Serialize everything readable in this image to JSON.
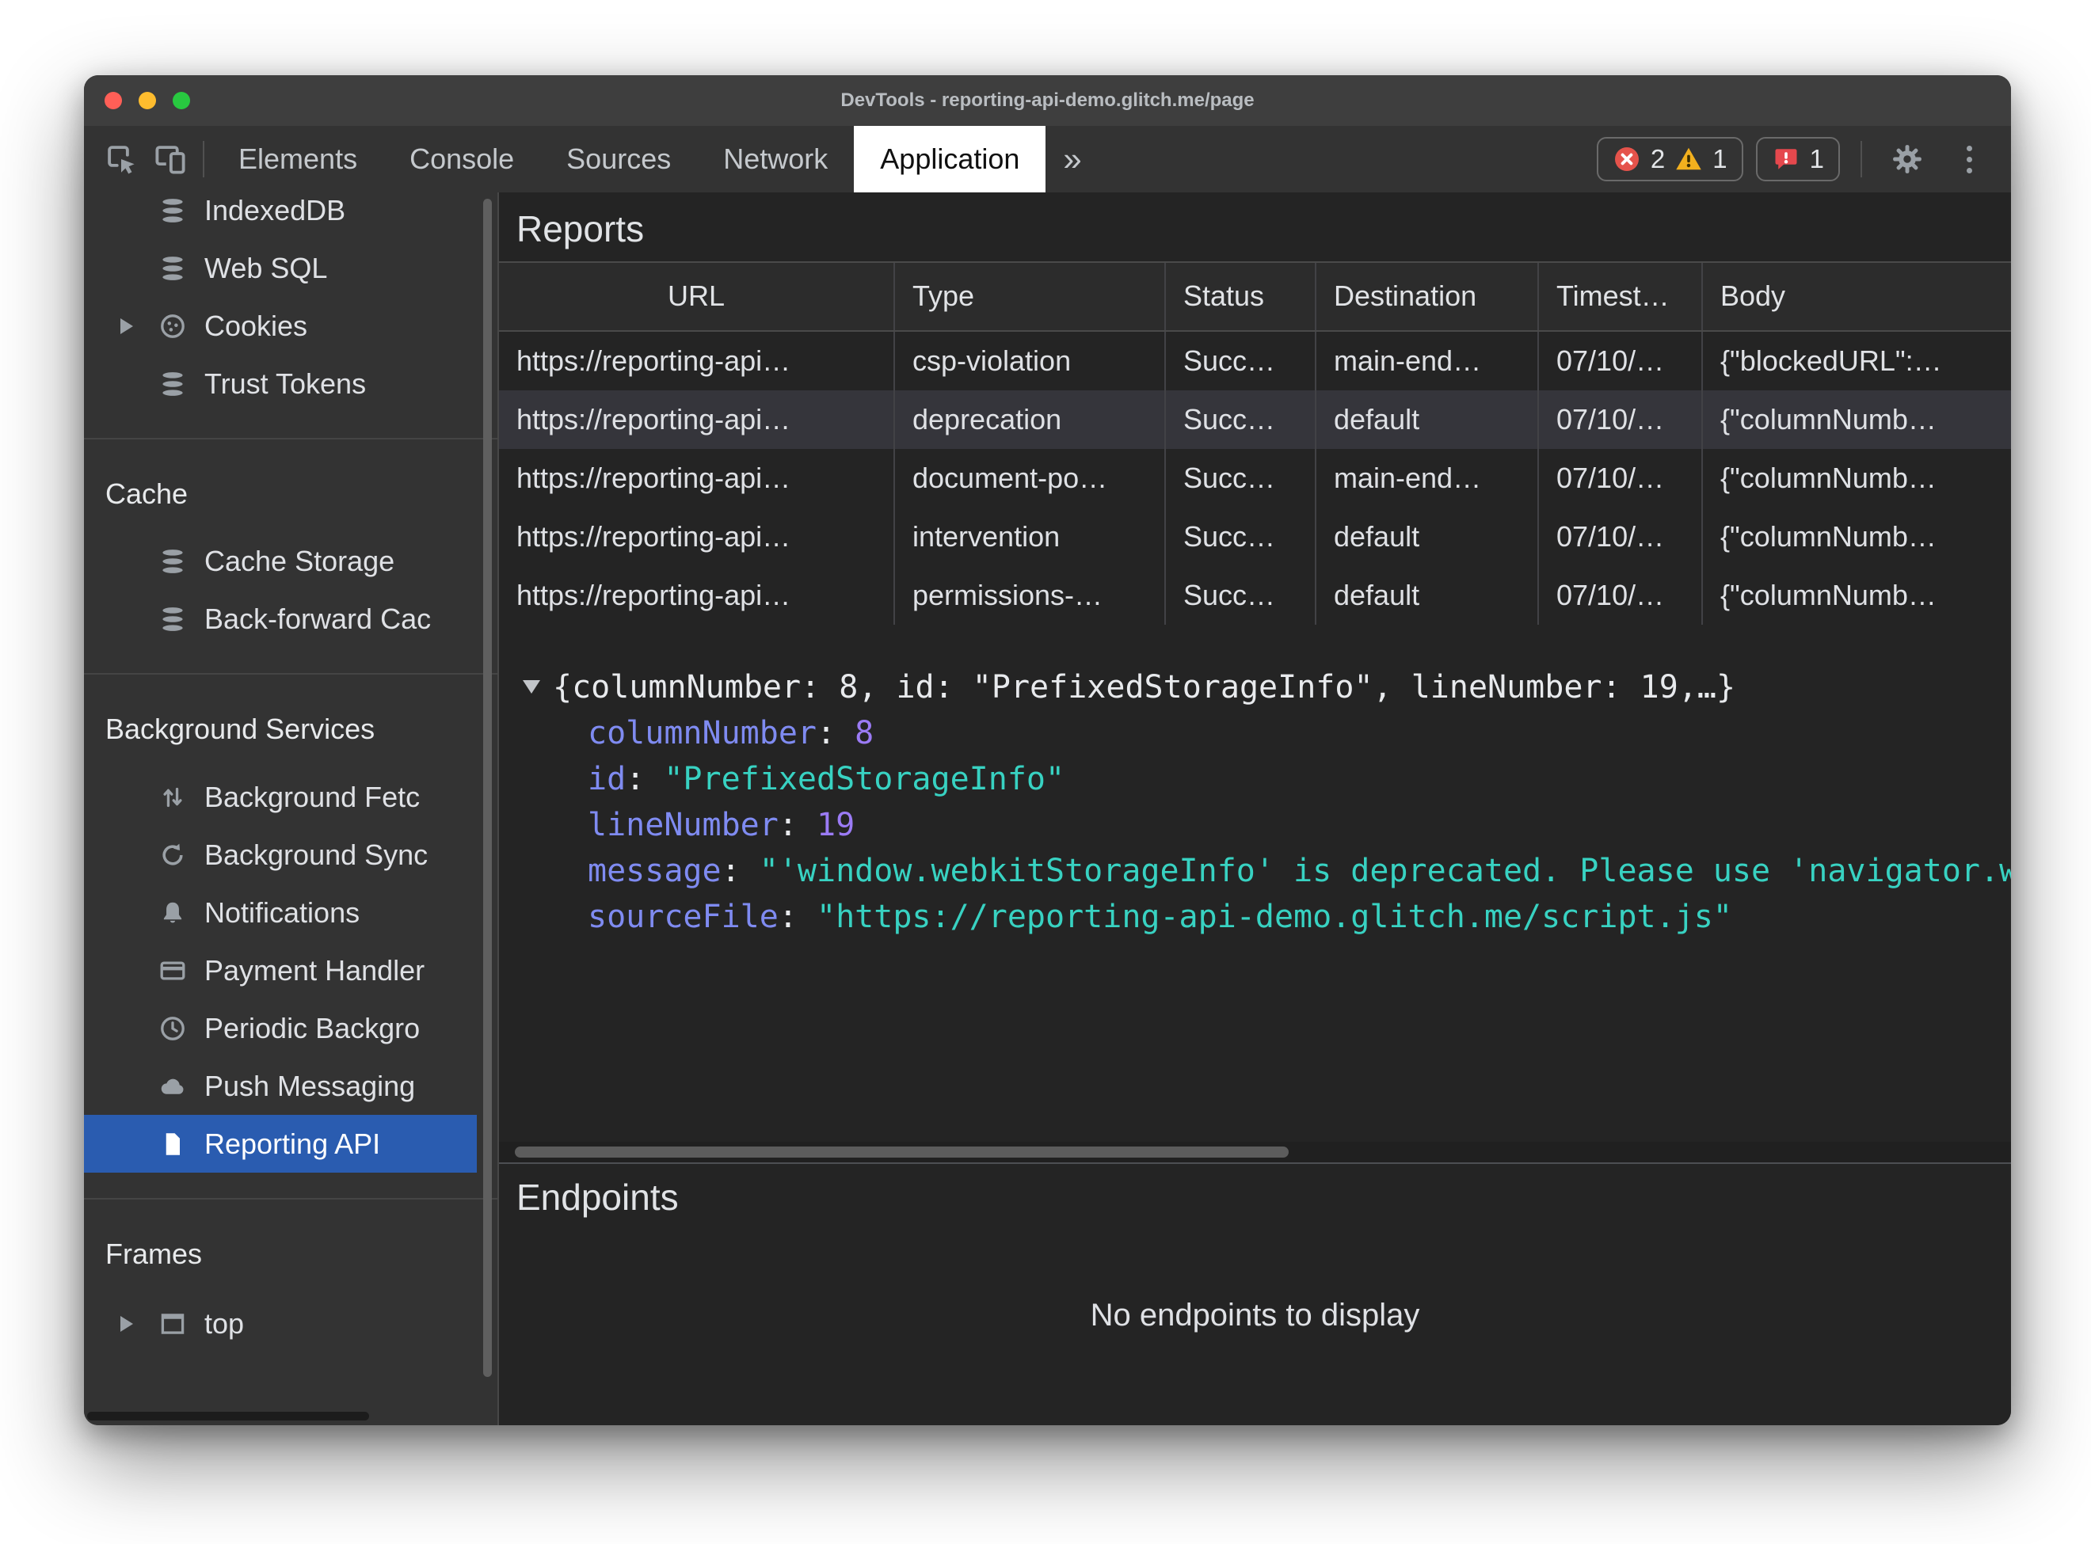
{
  "window": {
    "title": "DevTools - reporting-api-demo.glitch.me/page"
  },
  "tabbar": {
    "tabs": [
      "Elements",
      "Console",
      "Sources",
      "Network",
      "Application"
    ],
    "more_tabs": "»",
    "error_count": "2",
    "warning_count": "1",
    "issues_count": "1"
  },
  "sidebar": {
    "storage_items": [
      {
        "label": "IndexedDB",
        "icon": "database-icon"
      },
      {
        "label": "Web SQL",
        "icon": "database-icon"
      },
      {
        "label": "Cookies",
        "icon": "cookie-icon"
      },
      {
        "label": "Trust Tokens",
        "icon": "database-icon"
      }
    ],
    "cache_header": "Cache",
    "cache_items": [
      {
        "label": "Cache Storage",
        "icon": "database-icon"
      },
      {
        "label": "Back-forward Cac",
        "icon": "database-icon"
      }
    ],
    "background_header": "Background Services",
    "background_items": [
      {
        "label": "Background Fetc",
        "icon": "background-fetch-icon"
      },
      {
        "label": "Background Sync",
        "icon": "background-sync-icon"
      },
      {
        "label": "Notifications",
        "icon": "bell-icon"
      },
      {
        "label": "Payment Handler",
        "icon": "payment-card-icon"
      },
      {
        "label": "Periodic Backgro",
        "icon": "clock-icon"
      },
      {
        "label": "Push Messaging",
        "icon": "cloud-icon"
      },
      {
        "label": "Reporting API",
        "icon": "document-icon",
        "selected": true
      }
    ],
    "frames_header": "Frames",
    "frames_items": [
      {
        "label": "top",
        "icon": "frame-icon"
      }
    ]
  },
  "reports": {
    "title": "Reports",
    "columns": [
      "URL",
      "Type",
      "Status",
      "Destination",
      "Timest…",
      "Body"
    ],
    "rows": [
      {
        "url": "https://reporting-api…",
        "type": "csp-violation",
        "status": "Succ…",
        "destination": "main-end…",
        "timestamp": "07/10/…",
        "body": "{\"blockedURL\":…"
      },
      {
        "url": "https://reporting-api…",
        "type": "deprecation",
        "status": "Succ…",
        "destination": "default",
        "timestamp": "07/10/…",
        "body": "{\"columnNumb…"
      },
      {
        "url": "https://reporting-api…",
        "type": "document-po…",
        "status": "Succ…",
        "destination": "main-end…",
        "timestamp": "07/10/…",
        "body": "{\"columnNumb…"
      },
      {
        "url": "https://reporting-api…",
        "type": "intervention",
        "status": "Succ…",
        "destination": "default",
        "timestamp": "07/10/…",
        "body": "{\"columnNumb…"
      },
      {
        "url": "https://reporting-api…",
        "type": "permissions-…",
        "status": "Succ…",
        "destination": "default",
        "timestamp": "07/10/…",
        "body": "{\"columnNumb…"
      }
    ]
  },
  "report_detail": {
    "preview": "{columnNumber: 8, id: \"PrefixedStorageInfo\", lineNumber: 19,…}",
    "colon": ": ",
    "properties": [
      {
        "key": "columnNumber",
        "value": "8",
        "type": "number"
      },
      {
        "key": "id",
        "value": "\"PrefixedStorageInfo\"",
        "type": "string"
      },
      {
        "key": "lineNumber",
        "value": "19",
        "type": "number"
      },
      {
        "key": "message",
        "value": "\"'window.webkitStorageInfo' is deprecated. Please use 'navigator.w",
        "type": "string"
      },
      {
        "key": "sourceFile",
        "value": "\"https://reporting-api-demo.glitch.me/script.js\"",
        "type": "string"
      }
    ]
  },
  "endpoints": {
    "title": "Endpoints",
    "empty_message": "No endpoints to display"
  },
  "colors": {
    "selection_blue": "#2a5cb0",
    "error_red": "#e5534b",
    "warning_yellow": "#f2b01e",
    "issues_red": "#e5484d",
    "key_purple": "#7f8bf1",
    "number_purple": "#9b7bf5",
    "string_teal": "#38d2c2"
  }
}
